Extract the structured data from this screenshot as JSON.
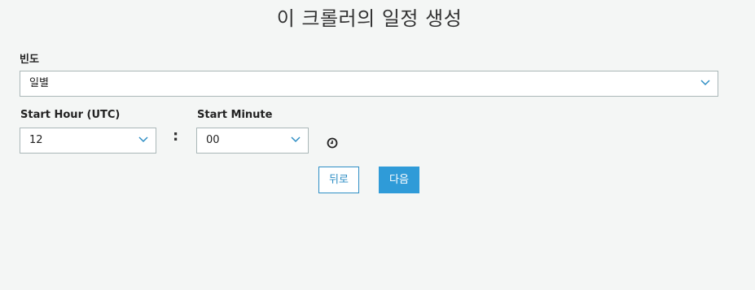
{
  "header": {
    "title": "이 크롤러의 일정 생성"
  },
  "frequency": {
    "label": "빈도",
    "value": "일별"
  },
  "start_hour": {
    "label": "Start Hour (UTC)",
    "value": "12"
  },
  "separator": ":",
  "start_minute": {
    "label": "Start Minute",
    "value": "00"
  },
  "icons": {
    "dropdown": "chevron-down-icon",
    "time": "clock-icon"
  },
  "actions": {
    "back_label": "뒤로",
    "next_label": "다음"
  },
  "colors": {
    "accent": "#2f9bd8",
    "border": "#aab7b8",
    "background": "#f4f6f5"
  }
}
